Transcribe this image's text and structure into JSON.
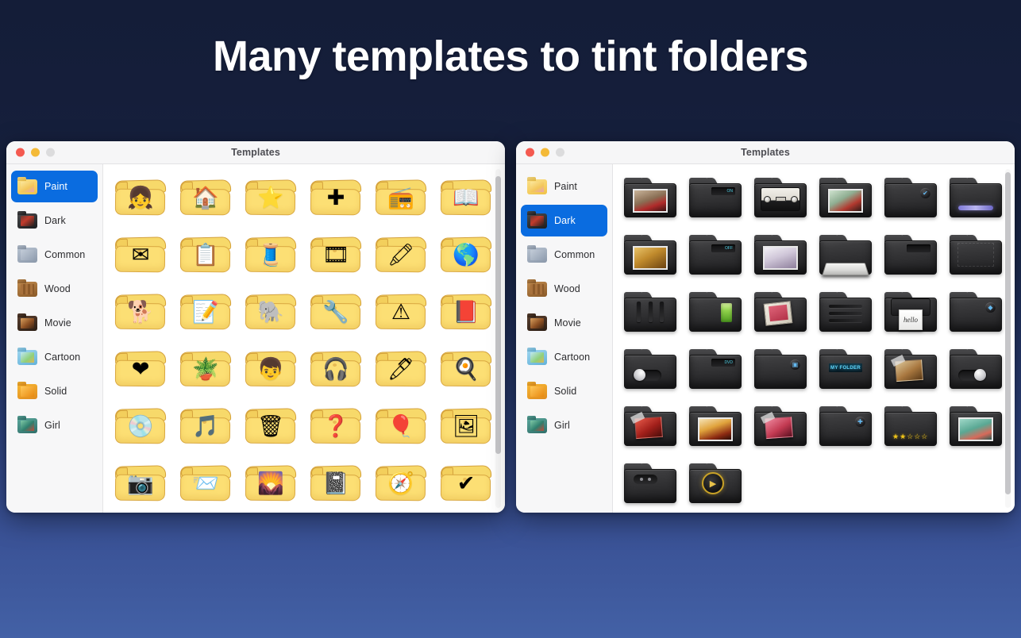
{
  "headline": "Many templates to tint folders",
  "background": {
    "top_color": "#141d38",
    "bottom_color": "#4361a6"
  },
  "accent_color": "#0a6ce0",
  "windows": [
    {
      "id": "left",
      "title": "Templates",
      "traffic_lights": [
        "close",
        "minimize",
        "zoom"
      ],
      "sidebar": {
        "selected": "Paint",
        "items": [
          {
            "label": "Paint",
            "icon": "folder-paint-icon"
          },
          {
            "label": "Dark",
            "icon": "folder-dark-icon"
          },
          {
            "label": "Common",
            "icon": "folder-common-icon"
          },
          {
            "label": "Wood",
            "icon": "folder-wood-icon"
          },
          {
            "label": "Movie",
            "icon": "folder-movie-icon"
          },
          {
            "label": "Cartoon",
            "icon": "folder-cartoon-icon"
          },
          {
            "label": "Solid",
            "icon": "folder-solid-icon"
          },
          {
            "label": "Girl",
            "icon": "folder-girl-icon"
          }
        ]
      },
      "grid": {
        "columns": 6,
        "style": "paint",
        "items": [
          {
            "name": "folder-girl",
            "glyph": "👧"
          },
          {
            "name": "folder-house",
            "glyph": "🏠"
          },
          {
            "name": "folder-star",
            "glyph": "⭐"
          },
          {
            "name": "folder-first-aid",
            "glyph": "✚"
          },
          {
            "name": "folder-radio",
            "glyph": "📻"
          },
          {
            "name": "folder-magazine",
            "glyph": "📖"
          },
          {
            "name": "folder-envelope",
            "glyph": "✉"
          },
          {
            "name": "folder-clipboard",
            "glyph": "📋"
          },
          {
            "name": "folder-zipper",
            "glyph": "🧵"
          },
          {
            "name": "folder-film",
            "glyph": "🎞"
          },
          {
            "name": "folder-supplies",
            "glyph": "🖍"
          },
          {
            "name": "folder-globe-arrow",
            "glyph": "🌎"
          },
          {
            "name": "folder-dog",
            "glyph": "🐕"
          },
          {
            "name": "folder-notes",
            "glyph": "📝"
          },
          {
            "name": "folder-elephant",
            "glyph": "🐘"
          },
          {
            "name": "folder-tools",
            "glyph": "🔧"
          },
          {
            "name": "folder-warning",
            "glyph": "⚠"
          },
          {
            "name": "folder-book",
            "glyph": "📕"
          },
          {
            "name": "folder-heart-plus",
            "glyph": "❤"
          },
          {
            "name": "folder-plant",
            "glyph": "🪴"
          },
          {
            "name": "folder-boy",
            "glyph": "👦"
          },
          {
            "name": "folder-headphones",
            "glyph": "🎧"
          },
          {
            "name": "folder-stapler",
            "glyph": "🖊"
          },
          {
            "name": "folder-pan",
            "glyph": "🍳"
          },
          {
            "name": "folder-burn-disc",
            "glyph": "💿"
          },
          {
            "name": "folder-music-player",
            "glyph": "🎵"
          },
          {
            "name": "folder-trash",
            "glyph": "🗑"
          },
          {
            "name": "folder-question",
            "glyph": "❓"
          },
          {
            "name": "folder-balloons",
            "glyph": "🎈"
          },
          {
            "name": "folder-album",
            "glyph": "🖼"
          },
          {
            "name": "folder-camera",
            "glyph": "📷"
          },
          {
            "name": "folder-green-mail",
            "glyph": "📨"
          },
          {
            "name": "folder-photos",
            "glyph": "🌄"
          },
          {
            "name": "folder-notebook",
            "glyph": "📓"
          },
          {
            "name": "folder-compass",
            "glyph": "🧭"
          },
          {
            "name": "folder-check",
            "glyph": "✔"
          }
        ]
      },
      "scrollbar": {
        "thumb_top_pct": 2,
        "thumb_height_pct": 82
      }
    },
    {
      "id": "right",
      "title": "Templates",
      "traffic_lights": [
        "close",
        "minimize",
        "zoom"
      ],
      "sidebar": {
        "selected": "Dark",
        "items": [
          {
            "label": "Paint",
            "icon": "folder-paint-icon"
          },
          {
            "label": "Dark",
            "icon": "folder-dark-icon"
          },
          {
            "label": "Common",
            "icon": "folder-common-icon"
          },
          {
            "label": "Wood",
            "icon": "folder-wood-icon"
          },
          {
            "label": "Movie",
            "icon": "folder-movie-icon"
          },
          {
            "label": "Cartoon",
            "icon": "folder-cartoon-icon"
          },
          {
            "label": "Solid",
            "icon": "folder-solid-icon"
          },
          {
            "label": "Girl",
            "icon": "folder-girl-icon"
          }
        ]
      },
      "grid": {
        "columns": 6,
        "style": "dark",
        "items": [
          {
            "name": "dark-folder-portrait-red",
            "variant": "photo",
            "photo": "red-figure"
          },
          {
            "name": "dark-folder-slot-label",
            "variant": "slot",
            "text": "ON"
          },
          {
            "name": "dark-folder-cassette",
            "variant": "cassette"
          },
          {
            "name": "dark-folder-anime-frame",
            "variant": "photo",
            "photo": "anime-red"
          },
          {
            "name": "dark-folder-check-badge",
            "variant": "badge",
            "text": "✔"
          },
          {
            "name": "dark-folder-light-bar",
            "variant": "bar"
          },
          {
            "name": "dark-folder-golden-photo",
            "variant": "photo",
            "photo": "golden"
          },
          {
            "name": "dark-folder-slot-dim",
            "variant": "slot",
            "text": "OFF"
          },
          {
            "name": "dark-folder-anime-face",
            "variant": "photo",
            "photo": "anime-white"
          },
          {
            "name": "dark-folder-keyboard",
            "variant": "keyboard"
          },
          {
            "name": "dark-folder-slim-slot",
            "variant": "slot",
            "text": ""
          },
          {
            "name": "dark-folder-corners",
            "variant": "corners"
          },
          {
            "name": "dark-folder-pens",
            "variant": "pens"
          },
          {
            "name": "dark-folder-battery",
            "variant": "battery"
          },
          {
            "name": "dark-folder-snacks",
            "variant": "snacks"
          },
          {
            "name": "dark-folder-stripes",
            "variant": "stripes"
          },
          {
            "name": "dark-folder-printer-hello",
            "variant": "printer",
            "text": "hello"
          },
          {
            "name": "dark-folder-gem-badge",
            "variant": "badge",
            "text": "◆"
          },
          {
            "name": "dark-folder-toggle-left",
            "variant": "toggle-left"
          },
          {
            "name": "dark-folder-dvd-slot",
            "variant": "slot",
            "text": "DVD"
          },
          {
            "name": "dark-folder-blue-badge",
            "variant": "badge",
            "text": "▣"
          },
          {
            "name": "dark-folder-my-folder",
            "variant": "label",
            "text": "MY FOLDER"
          },
          {
            "name": "dark-folder-taped-photo",
            "variant": "tape",
            "photo": "sepia"
          },
          {
            "name": "dark-folder-toggle-right",
            "variant": "toggle"
          },
          {
            "name": "dark-folder-red-taped",
            "variant": "tape",
            "photo": "red-bloom"
          },
          {
            "name": "dark-folder-fire-photo",
            "variant": "photo",
            "photo": "fire"
          },
          {
            "name": "dark-folder-rose-taped",
            "variant": "tape",
            "photo": "rose"
          },
          {
            "name": "dark-folder-plus-badge",
            "variant": "badge",
            "text": "✚"
          },
          {
            "name": "dark-folder-rating-stars",
            "variant": "stars",
            "text": "★★☆☆☆"
          },
          {
            "name": "dark-folder-mint-portrait",
            "variant": "photo",
            "photo": "mint"
          },
          {
            "name": "dark-folder-dual-dot",
            "variant": "dual-dot"
          },
          {
            "name": "dark-folder-play-knob",
            "variant": "knob",
            "text": "▶"
          }
        ]
      },
      "scrollbar": {
        "thumb_top_pct": 1,
        "thumb_height_pct": 95
      }
    }
  ]
}
